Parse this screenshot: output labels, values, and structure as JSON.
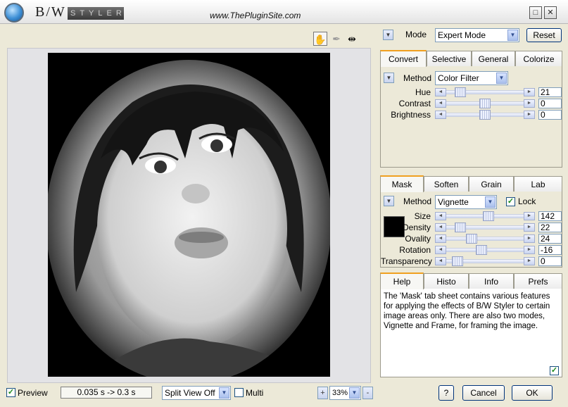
{
  "app": {
    "logo_text": "B/W",
    "logo_badge": "STYLER",
    "site_url": "www.ThePluginSite.com",
    "window_maximize": "□",
    "window_close": "✕"
  },
  "toolbar": {
    "hand_icon": "✋",
    "picker_icon": "✒",
    "split_icon": "⇹"
  },
  "mode": {
    "label": "Mode",
    "value": "Expert Mode",
    "reset_label": "Reset"
  },
  "convert_tabs": [
    "Convert",
    "Selective",
    "General",
    "Colorize"
  ],
  "convert": {
    "method_label": "Method",
    "method_value": "Color Filter",
    "sliders": [
      {
        "label": "Hue",
        "value": "21",
        "pos": 0.13
      },
      {
        "label": "Contrast",
        "value": "0",
        "pos": 0.5
      },
      {
        "label": "Brightness",
        "value": "0",
        "pos": 0.5
      }
    ]
  },
  "mask_tabs": [
    "Mask",
    "Soften",
    "Grain",
    "Lab"
  ],
  "mask": {
    "method_label": "Method",
    "method_value": "Vignette",
    "lock_label": "Lock",
    "lock_checked": true,
    "swatch_color": "#000000",
    "sliders": [
      {
        "label": "Size",
        "value": "142",
        "pos": 0.55
      },
      {
        "label": "Density",
        "value": "22",
        "pos": 0.13
      },
      {
        "label": "Ovality",
        "value": "24",
        "pos": 0.3
      },
      {
        "label": "Rotation",
        "value": "-16",
        "pos": 0.45
      },
      {
        "label": "Transparency",
        "value": "0",
        "pos": 0.08
      }
    ]
  },
  "help_tabs": [
    "Help",
    "Histo",
    "Info",
    "Prefs"
  ],
  "help": {
    "text": "The 'Mask' tab sheet contains various features for applying the effects of B/W Styler to certain image areas only. There are also two modes, Vignette and Frame, for framing the image."
  },
  "bottom": {
    "preview_label": "Preview",
    "preview_checked": true,
    "timing": "0.035 s -> 0.3 s",
    "split_view": "Split View Off",
    "multi_label": "Multi",
    "zoom_in": "+",
    "zoom_value": "33%",
    "zoom_out": "-",
    "help_button": "?",
    "cancel_label": "Cancel",
    "ok_label": "OK"
  }
}
